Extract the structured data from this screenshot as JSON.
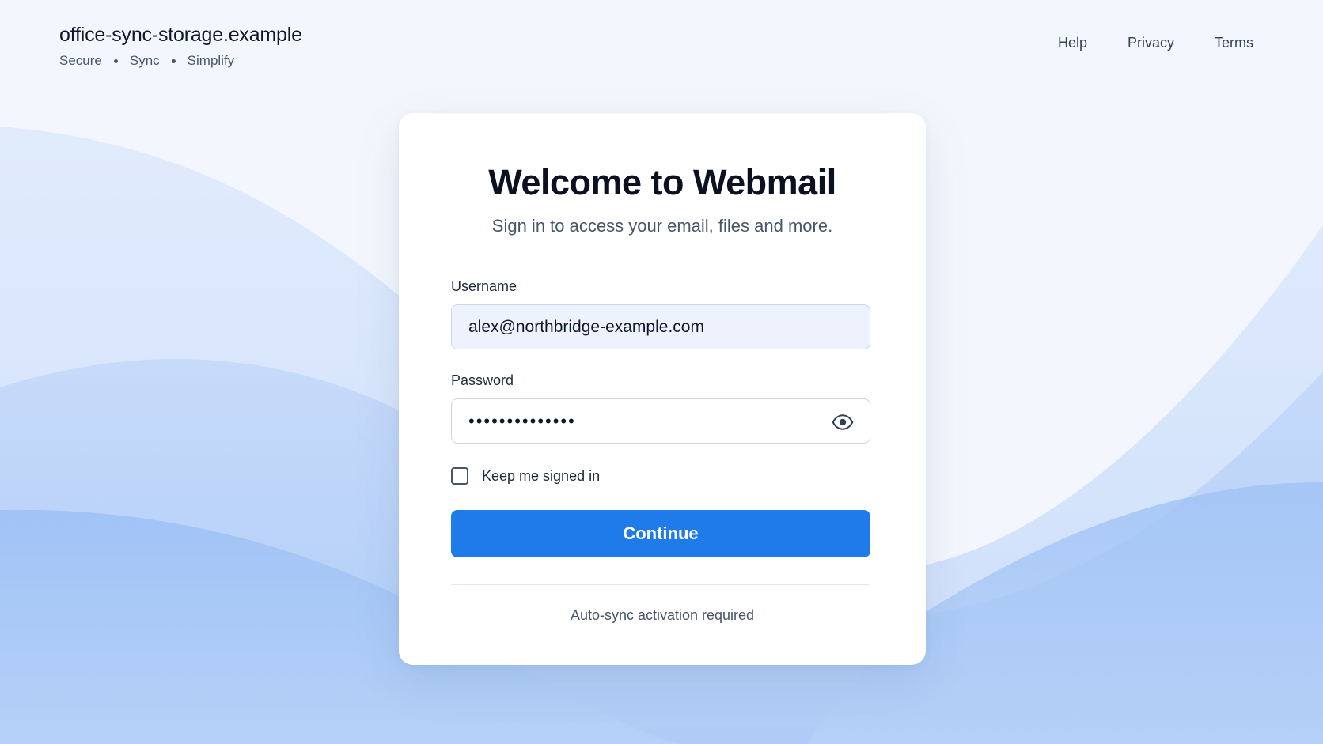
{
  "header": {
    "domain": "office-sync-storage.example",
    "tagline": [
      "Secure",
      "Sync",
      "Simplify"
    ]
  },
  "nav": {
    "help": "Help",
    "privacy": "Privacy",
    "terms": "Terms"
  },
  "card": {
    "title": "Welcome to Webmail",
    "subtitle": "Sign in to access your email, files and more.",
    "username_label": "Username",
    "username_value": "alex@northbridge-example.com",
    "password_label": "Password",
    "password_masked": "••••••••••••••",
    "remember_label": "Keep me signed in",
    "remember_checked": false,
    "continue_label": "Continue",
    "footer_note": "Auto-sync activation required",
    "password_toggle_icon": "eye-icon"
  },
  "colors": {
    "primary": "#1f7aea",
    "input_bg": "#edf2fd",
    "text_dark": "#0b1120",
    "text_muted": "#475569"
  }
}
